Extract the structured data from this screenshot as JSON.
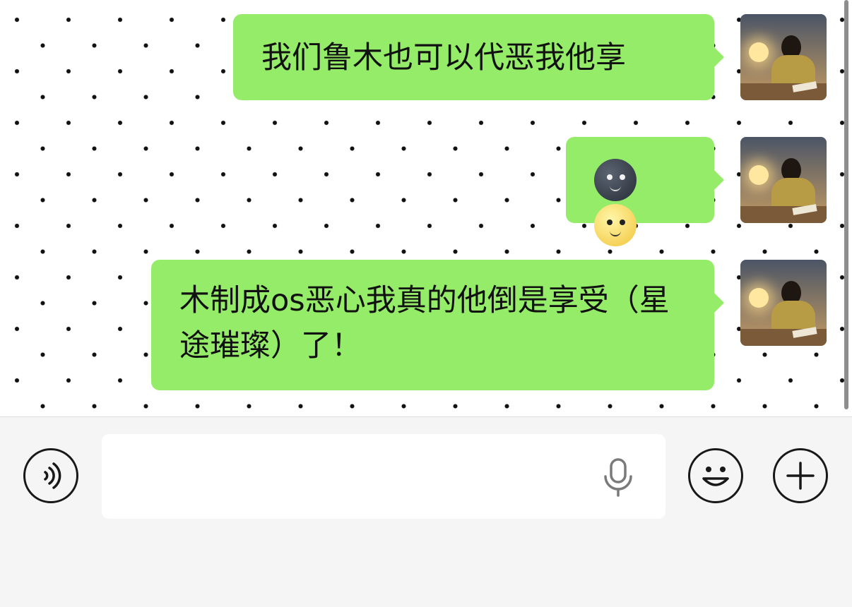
{
  "chat": {
    "messages": [
      {
        "sender": "me",
        "type": "text",
        "text": "我们鲁木也可以代恶我他享"
      },
      {
        "sender": "me",
        "type": "emoji",
        "emojis": [
          "new-moon-face",
          "full-moon-face"
        ]
      },
      {
        "sender": "me",
        "type": "text",
        "text": "木制成os恶心我真的他倒是享受（星途璀璨）了！"
      }
    ],
    "bubble_color": "#95ec69"
  },
  "input_bar": {
    "value": "",
    "placeholder": "",
    "icons": {
      "voice": "voice-mode-icon",
      "mic": "microphone-icon",
      "emoji": "emoji-smiley-icon",
      "more": "plus-icon"
    }
  }
}
